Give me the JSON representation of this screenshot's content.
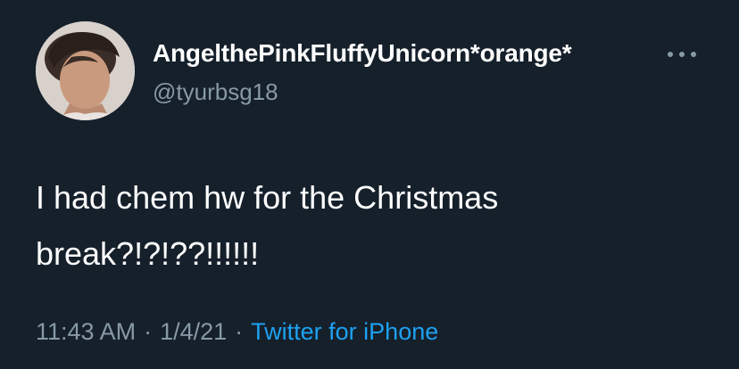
{
  "user": {
    "display_name": "AngelthePinkFluffyUnicorn*orange*",
    "handle": "@tyurbsg18"
  },
  "tweet": {
    "text": "I had chem hw for the Christmas\nbreak?!?!??!!!!!!",
    "time": "11:43 AM",
    "date": "1/4/21",
    "separator": "·",
    "source": "Twitter for iPhone"
  },
  "icons": {
    "more": "more-horizontal-icon",
    "avatar": "profile-photo"
  },
  "colors": {
    "background": "#15202b",
    "primary_text": "#ffffff",
    "secondary_text": "#8899a6",
    "link": "#1da1f2"
  }
}
